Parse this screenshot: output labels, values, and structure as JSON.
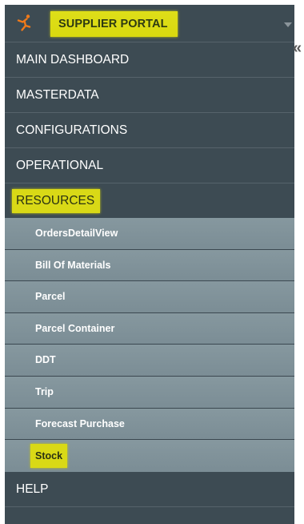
{
  "brand": {
    "title": "SUPPLIER PORTAL",
    "logo_icon": "running-figure-icon",
    "accent_color": "#f07a1a",
    "highlight_color": "#d9d916"
  },
  "collapse": {
    "glyph": "«"
  },
  "menu": {
    "items": [
      {
        "label": "MAIN DASHBOARD"
      },
      {
        "label": "MASTERDATA"
      },
      {
        "label": "CONFIGURATIONS"
      },
      {
        "label": "OPERATIONAL"
      }
    ],
    "resources": {
      "label": "RESOURCES",
      "subitems": [
        {
          "label": "OrdersDetailView"
        },
        {
          "label": "Bill Of Materials"
        },
        {
          "label": "Parcel"
        },
        {
          "label": "Parcel Container"
        },
        {
          "label": "DDT"
        },
        {
          "label": "Trip"
        },
        {
          "label": "Forecast Purchase"
        },
        {
          "label": "Stock"
        }
      ]
    },
    "help": {
      "label": "HELP"
    }
  }
}
